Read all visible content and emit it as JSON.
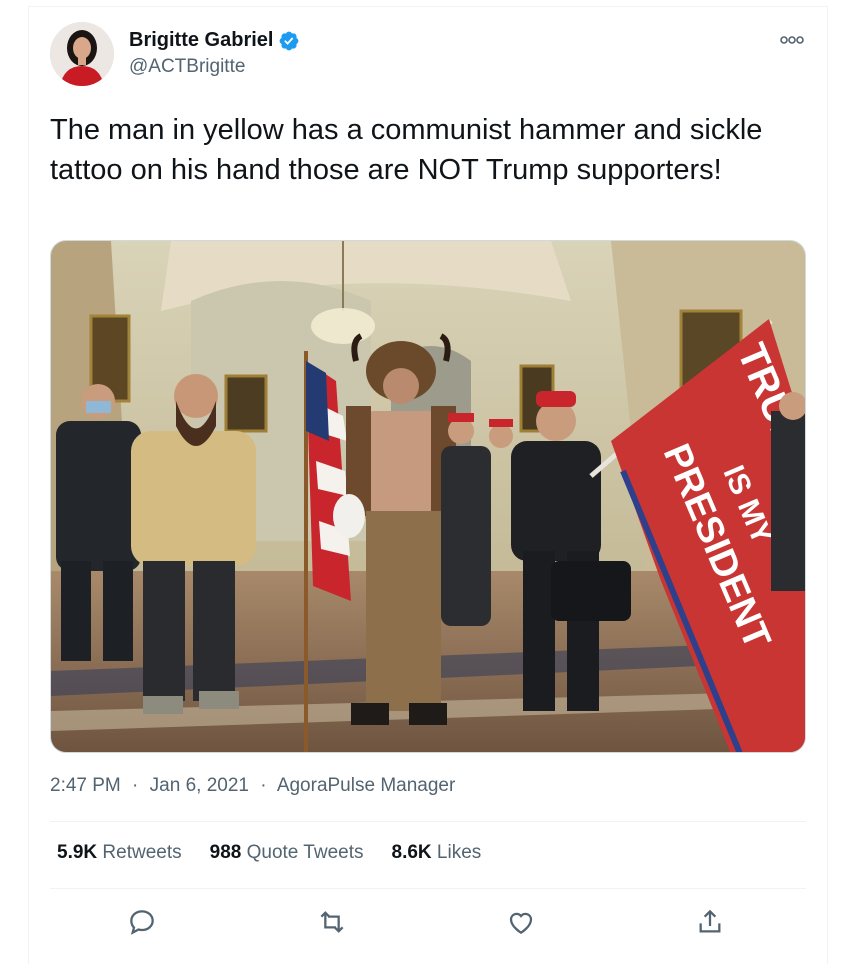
{
  "author": {
    "display_name": "Brigitte Gabriel",
    "handle": "@ACTBrigitte",
    "verified": true,
    "verified_icon": "verified-badge-icon",
    "avatar": "avatar-photo"
  },
  "tweet": {
    "text": "The man in yellow has a communist hammer and sickle tattoo on his hand those are NOT Trump supporters!",
    "media": {
      "flag_text_1": "TRUMP",
      "flag_text_2": "IS MY",
      "flag_text_3": "PRESIDENT"
    }
  },
  "meta": {
    "time": "2:47 PM",
    "separator": "·",
    "date": "Jan 6, 2021",
    "source": "AgoraPulse Manager"
  },
  "stats": {
    "retweets_count": "5.9K",
    "retweets_label": "Retweets",
    "quotes_count": "988",
    "quotes_label": "Quote Tweets",
    "likes_count": "8.6K",
    "likes_label": "Likes"
  },
  "actions": [
    "reply-icon",
    "retweet-icon",
    "like-icon",
    "share-icon"
  ],
  "colors": {
    "accent": "#1d9bf0",
    "text": "#0f1419",
    "secondary": "#536471",
    "border": "#eff3f4"
  }
}
